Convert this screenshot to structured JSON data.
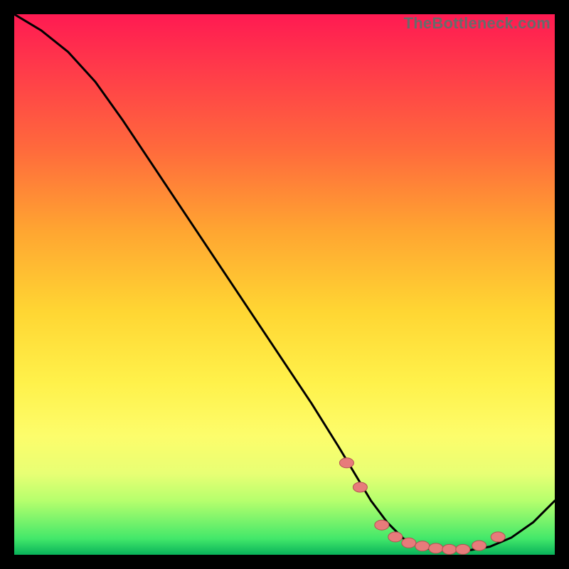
{
  "watermark": "TheBottleneck.com",
  "colors": {
    "curve": "#000000",
    "marker_fill": "#e77b7b",
    "marker_stroke": "#b35252",
    "gradient_top": "#ff1a52",
    "gradient_bottom": "#08b25a"
  },
  "chart_data": {
    "type": "line",
    "title": "",
    "xlabel": "",
    "ylabel": "",
    "xlim": [
      0,
      100
    ],
    "ylim": [
      0,
      100
    ],
    "series": [
      {
        "name": "bottleneck-curve",
        "x": [
          0,
          5,
          10,
          15,
          20,
          25,
          30,
          35,
          40,
          45,
          50,
          55,
          60,
          63,
          66,
          69,
          72,
          76,
          80,
          84,
          88,
          92,
          96,
          100
        ],
        "y": [
          100,
          97,
          93,
          87.5,
          80.5,
          73,
          65.5,
          58,
          50.5,
          43,
          35.5,
          28,
          20,
          15,
          10,
          6,
          3,
          1.2,
          0.8,
          0.8,
          1.5,
          3.2,
          6,
          10
        ]
      }
    ],
    "markers": {
      "name": "highlight-dots",
      "x": [
        61.5,
        64,
        68,
        70.5,
        73,
        75.5,
        78,
        80.5,
        83,
        86,
        89.5
      ],
      "y": [
        17,
        12.5,
        5.5,
        3.3,
        2.2,
        1.6,
        1.2,
        1.0,
        1.0,
        1.7,
        3.3
      ]
    }
  }
}
